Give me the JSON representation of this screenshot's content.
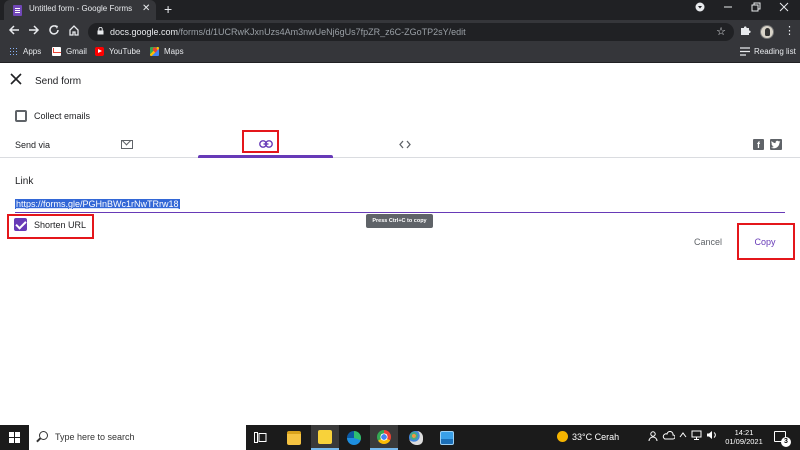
{
  "browser": {
    "tab_title": "Untitled form - Google Forms",
    "tab_close": "✕",
    "new_tab": "+",
    "url_host": "docs.google.com",
    "url_path": "/forms/d/1UCRwKJxnUzs4Am3nwUeNj6gUs7fpZR_z6C-ZGoTP2sY/edit",
    "bookmarks": [
      {
        "label": "Apps",
        "icon": "apps-icon"
      },
      {
        "label": "Gmail",
        "icon": "gmail-icon"
      },
      {
        "label": "YouTube",
        "icon": "youtube-icon"
      },
      {
        "label": "Maps",
        "icon": "maps-icon"
      }
    ],
    "reading_list": "Reading list"
  },
  "dialog": {
    "title": "Send form",
    "collect_emails_label": "Collect emails",
    "collect_emails_checked": false,
    "send_via_label": "Send via",
    "send_via_options": [
      {
        "name": "email",
        "icon": "mail-icon"
      },
      {
        "name": "link",
        "icon": "link-icon",
        "selected": true
      },
      {
        "name": "embed",
        "icon": "code-icon"
      }
    ],
    "link_heading": "Link",
    "link_url": "https://forms.gle/PGHnBWc1rNwTRrw18",
    "tooltip": "Press Ctrl+C to copy",
    "shorten_url_label": "Shorten URL",
    "shorten_url_checked": true,
    "cancel_label": "Cancel",
    "copy_label": "Copy"
  },
  "taskbar": {
    "search_placeholder": "Type here to search",
    "weather": "33°C  Cerah",
    "time": "14:21",
    "date": "01/09/2021",
    "notification_count": "3"
  },
  "colors": {
    "accent": "#673ab7",
    "highlight": "#e4161b",
    "selection": "#3367d6"
  }
}
